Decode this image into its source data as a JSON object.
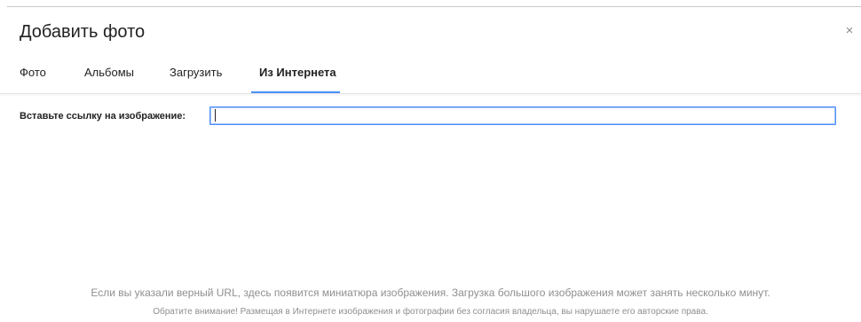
{
  "dialog": {
    "title": "Добавить фото",
    "close_symbol": "×"
  },
  "tabs": [
    {
      "label": "Фото",
      "active": false
    },
    {
      "label": "Альбомы",
      "active": false
    },
    {
      "label": "Загрузить",
      "active": false
    },
    {
      "label": "Из Интернета",
      "active": true
    }
  ],
  "url_form": {
    "label": "Вставьте ссылку на изображение:",
    "value": "",
    "placeholder": ""
  },
  "hints": {
    "preview_note": "Если вы указали верный URL, здесь появится миниатюра изображения. Загрузка большого изображения может занять несколько минут.",
    "copyright_warning": "Обратите внимание! Размещая в Интернете изображения и фотографии без согласия владельца, вы нарушаете его авторские права."
  },
  "colors": {
    "accent": "#4d90fe",
    "hint_text": "#8f8f8f",
    "text": "#222222"
  }
}
